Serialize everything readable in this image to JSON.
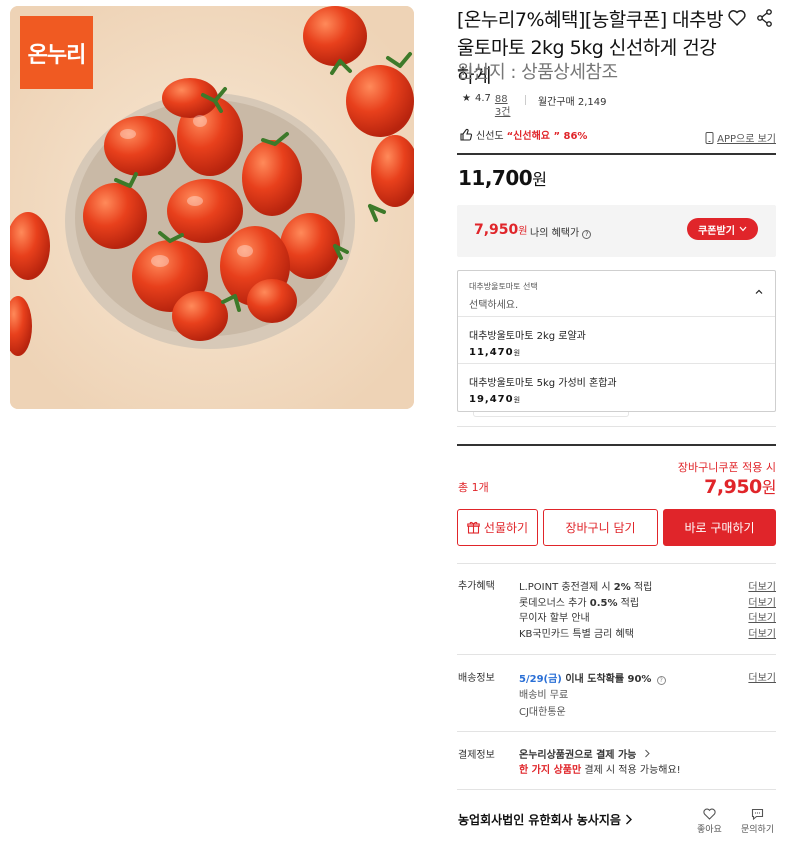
{
  "product": {
    "badge_text": "온누리",
    "title": "[온누리7%혜택][농할쿠폰] 대추방울토마토 2kg 5kg 신선하게 건강하게",
    "origin": "원산지 : 상품상세참조",
    "rating": "4.7",
    "review_count": "883건",
    "monthly_purchase": "월간구매 2,149",
    "freshness_label": "신선도",
    "freshness_value": "“신선해요 ” 86%",
    "app_link": "APP으로 보기"
  },
  "price": {
    "amount": "11,700",
    "unit": "원",
    "benefit_amount": "7,950",
    "benefit_unit": "원",
    "benefit_label": "나의 혜택가",
    "coupon_button": "쿠폰받기"
  },
  "option_select": {
    "label": "대추방울토마토 선택",
    "placeholder": "선택하세요.",
    "options": [
      {
        "name": "대추방울토마토 2kg 로얄과",
        "price": "11,470",
        "unit": "원"
      },
      {
        "name": "대추방울토마토 5kg 가성비 혼합과",
        "price": "19,470",
        "unit": "원"
      }
    ]
  },
  "total": {
    "cart_coupon_label": "장바구니쿠폰 적용 시",
    "count_label": "총 1개",
    "price": "7,950",
    "unit": "원"
  },
  "actions": {
    "gift": "선물하기",
    "cart": "장바구니 담기",
    "buy": "바로 구매하기"
  },
  "extra_benefits": {
    "label": "추가혜택",
    "items": [
      {
        "pre": "L.POINT 충전결제 시 ",
        "bold": "2%",
        "post": " 적립",
        "more": "더보기"
      },
      {
        "pre": "롯데오너스 추가 ",
        "bold": "0.5%",
        "post": " 적립",
        "more": "더보기"
      },
      {
        "pre": "무이자 할부 안내",
        "bold": "",
        "post": "",
        "more": "더보기"
      },
      {
        "pre": "KB국민카드 특별 금리 혜택",
        "bold": "",
        "post": "",
        "more": "더보기"
      }
    ]
  },
  "delivery": {
    "label": "배송정보",
    "date": "5/29(금)",
    "arrival": " 이내 도착확률 90%",
    "fee": "배송비 무료",
    "carrier": "CJ대한통운",
    "more": "더보기"
  },
  "payment": {
    "label": "결제정보",
    "line1": "온누리상품권으로 결제 가능",
    "line2_red": "한 가지 상품만",
    "line2_rest": " 결제 시 적용 가능해요!"
  },
  "seller": {
    "name": "농업회사법인 유한회사 농사지음",
    "like": "좋아요",
    "inquiry": "문의하기"
  },
  "colors": {
    "accent": "#e0252a",
    "badge": "#f05a22",
    "link_blue": "#2a6fd6"
  }
}
